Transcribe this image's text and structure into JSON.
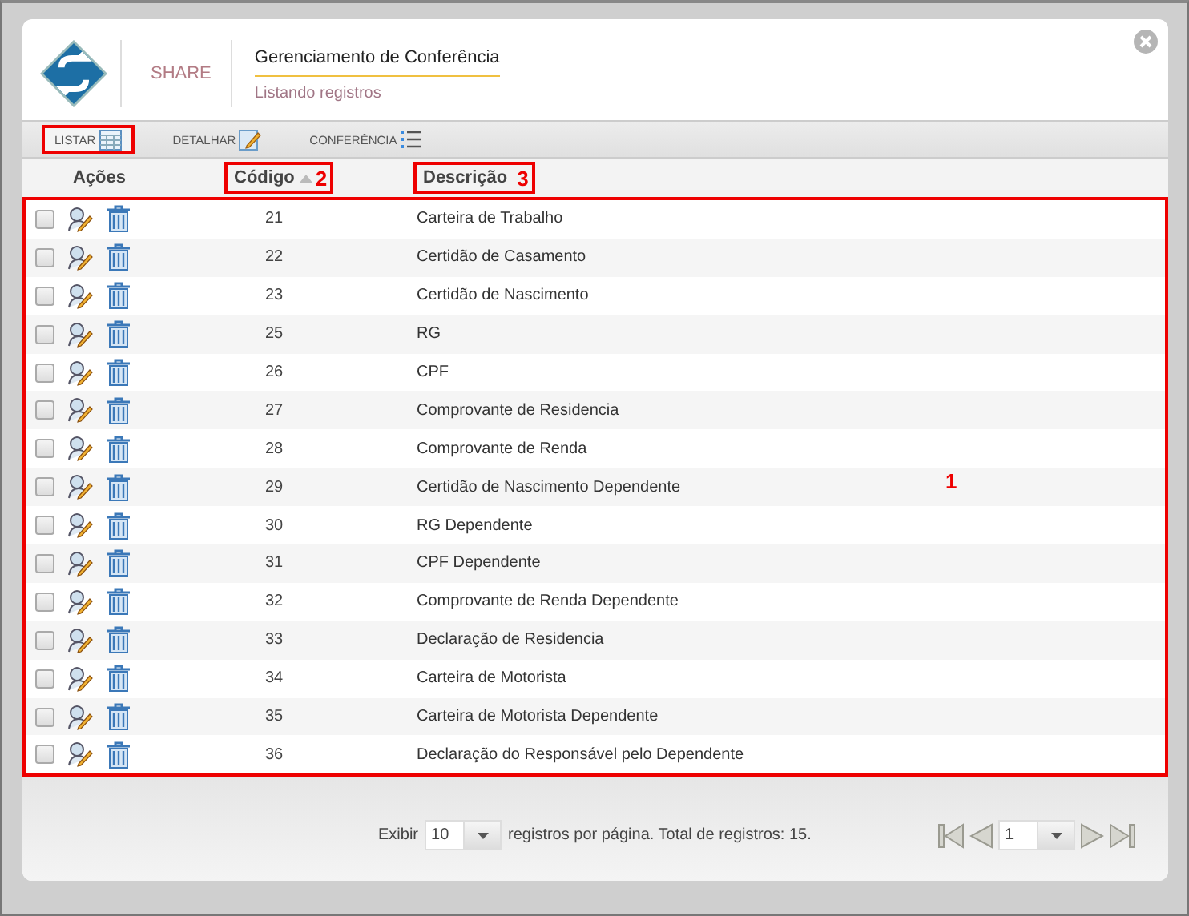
{
  "header": {
    "brand": "SHARE",
    "title": "Gerenciamento de Conferência",
    "subtitle": "Listando registros"
  },
  "tabs": [
    {
      "label": "LISTAR",
      "kind": "table",
      "selected": true,
      "highlighted": true
    },
    {
      "label": "DETALHAR",
      "kind": "edit",
      "selected": false,
      "highlighted": false
    },
    {
      "label": "CONFERÊNCIA",
      "kind": "list",
      "selected": false,
      "highlighted": false
    }
  ],
  "table": {
    "callout": "1",
    "columns": [
      {
        "label": "Ações",
        "sorted": false
      },
      {
        "label": "Código",
        "sorted": true,
        "callout": "2"
      },
      {
        "label": "Descrição",
        "sorted": false,
        "callout": "3"
      }
    ],
    "rows": [
      {
        "code": "21",
        "description": "Carteira de Trabalho",
        "checked": false
      },
      {
        "code": "22",
        "description": "Certidão de Casamento",
        "checked": false
      },
      {
        "code": "23",
        "description": "Certidão de Nascimento",
        "checked": false
      },
      {
        "code": "25",
        "description": "RG",
        "checked": false
      },
      {
        "code": "26",
        "description": "CPF",
        "checked": false
      },
      {
        "code": "27",
        "description": "Comprovante de Residencia",
        "checked": false
      },
      {
        "code": "28",
        "description": "Comprovante de Renda",
        "checked": false
      },
      {
        "code": "29",
        "description": "Certidão de Nascimento Dependente",
        "checked": false
      },
      {
        "code": "30",
        "description": "RG Dependente",
        "checked": false
      },
      {
        "code": "31",
        "description": "CPF Dependente",
        "checked": false
      },
      {
        "code": "32",
        "description": "Comprovante de Renda Dependente",
        "checked": false
      },
      {
        "code": "33",
        "description": "Declaração de Residencia",
        "checked": false
      },
      {
        "code": "34",
        "description": "Carteira de Motorista",
        "checked": false
      },
      {
        "code": "35",
        "description": "Carteira de Motorista Dependente",
        "checked": false
      },
      {
        "code": "36",
        "description": "Declaração do Responsável pelo Dependente",
        "checked": false
      }
    ]
  },
  "pagination": {
    "show_label": "Exibir",
    "page_size": "10",
    "summary": "registros por página. Total de registros: 15.",
    "page": "1"
  }
}
